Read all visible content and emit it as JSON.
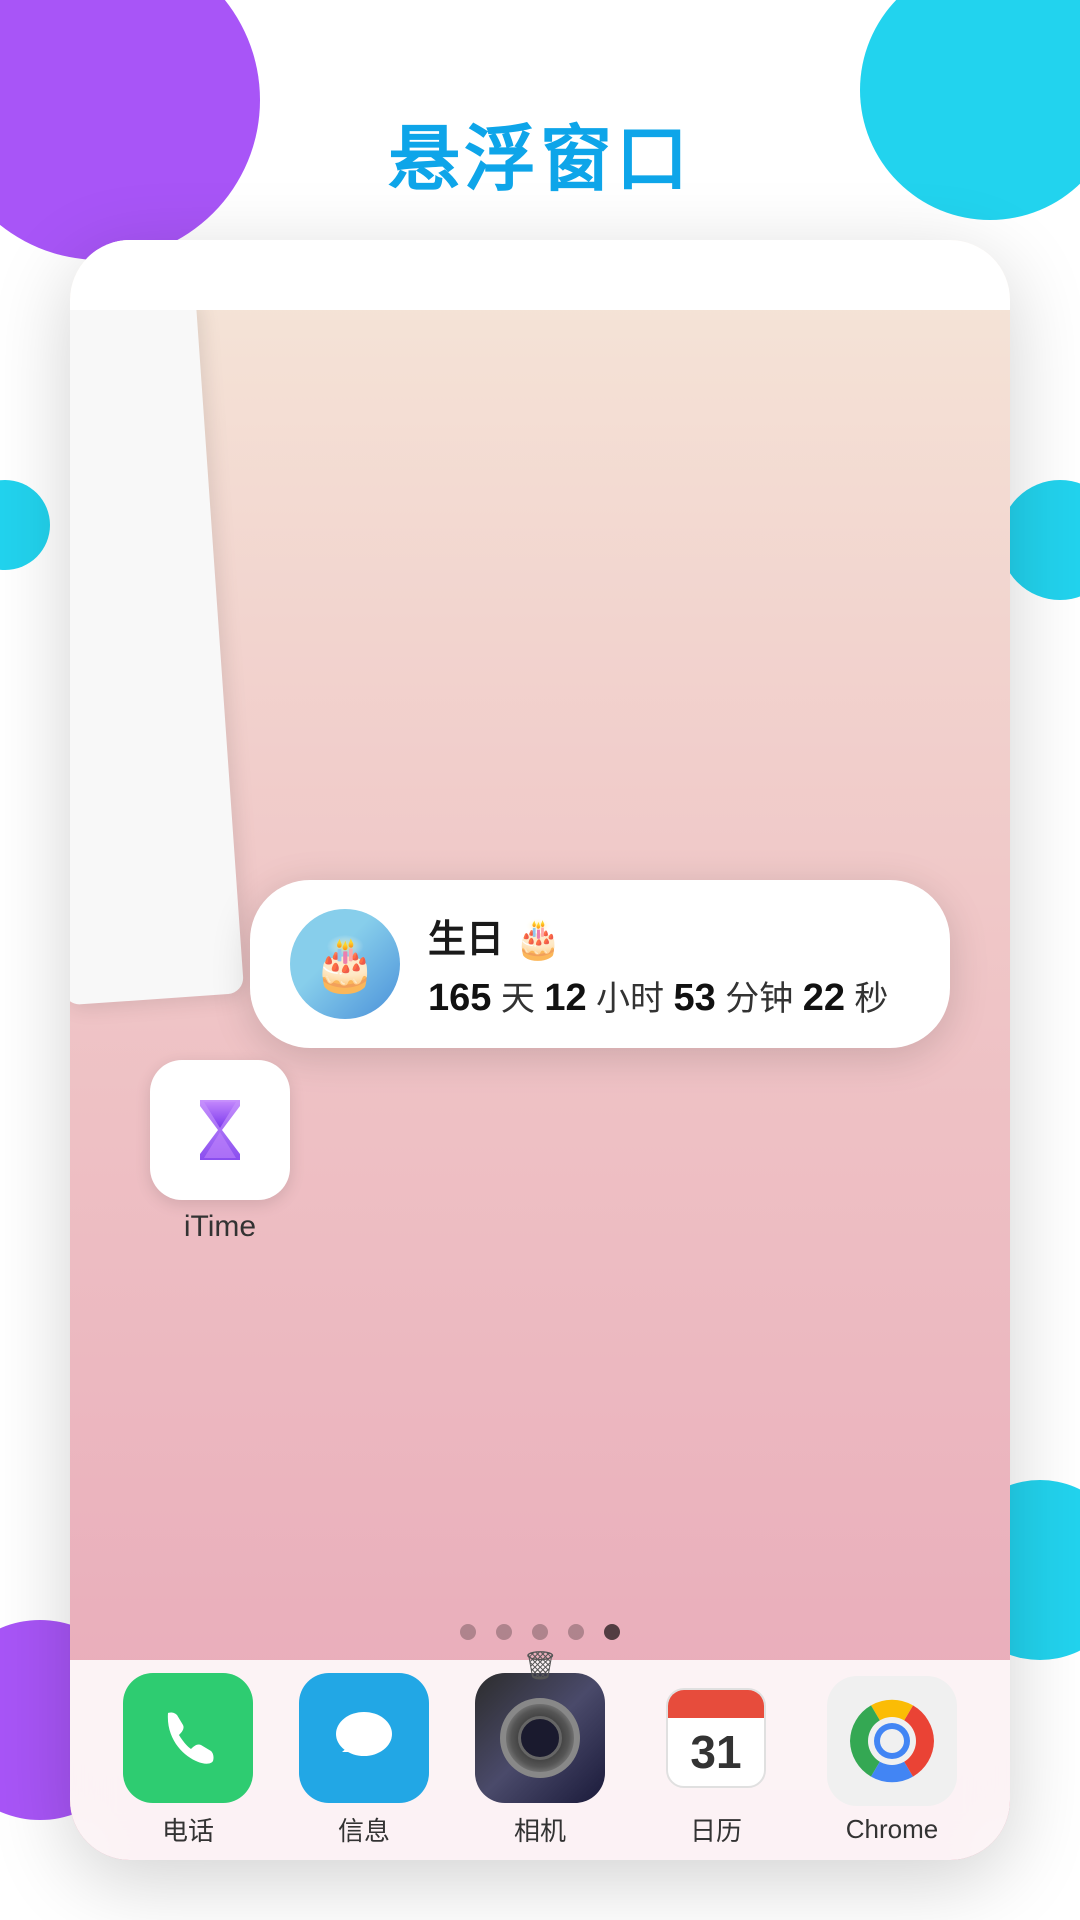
{
  "page": {
    "title": "悬浮窗口",
    "background_colors": {
      "purple": "#a855f7",
      "cyan": "#22d3ee",
      "white": "#ffffff"
    }
  },
  "widget": {
    "title": "生日 🎂",
    "countdown": {
      "days": "165",
      "days_label": "天",
      "hours": "12",
      "hours_label": "小时",
      "minutes": "53",
      "minutes_label": "分钟",
      "seconds": "22",
      "seconds_label": "秒"
    },
    "avatar_emoji": "🎂"
  },
  "itime_app": {
    "label": "iTime",
    "icon_symbol": "⌛"
  },
  "page_dots": {
    "total": 5,
    "active": 4
  },
  "dock": {
    "items": [
      {
        "id": "phone",
        "label": "电话",
        "emoji": "📞"
      },
      {
        "id": "messages",
        "label": "信息",
        "emoji": "💬"
      },
      {
        "id": "camera",
        "label": "相机",
        "emoji": ""
      },
      {
        "id": "calendar",
        "label": "日历",
        "number": "31"
      },
      {
        "id": "chrome",
        "label": "Chrome",
        "emoji": ""
      }
    ]
  }
}
